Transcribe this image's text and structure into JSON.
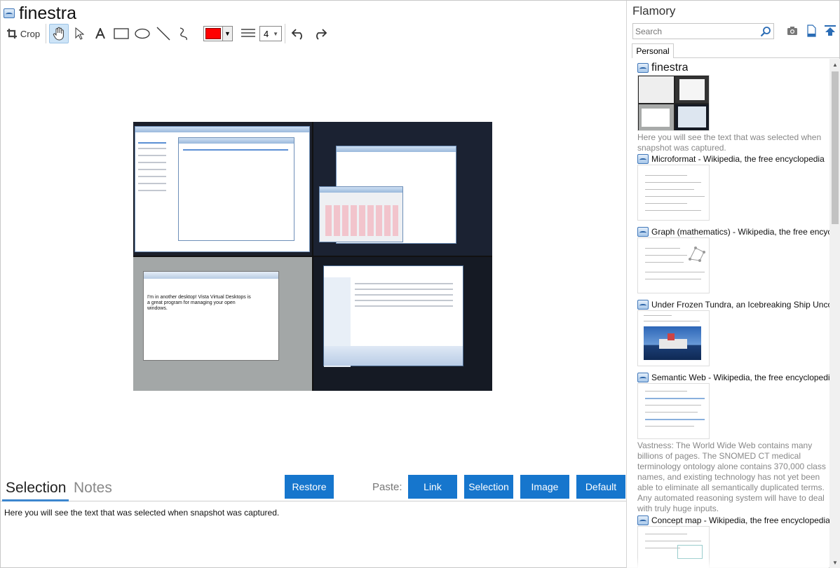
{
  "header": {
    "title": "finestra"
  },
  "toolbar": {
    "crop_label": "Crop",
    "line_width": "4",
    "accent_color": "#ff0000"
  },
  "canvas": {
    "q3_text": "I'm in another desktop! Vista Virtual Desktops is a great program for managing your open windows."
  },
  "bottom": {
    "tabs": [
      "Selection",
      "Notes"
    ],
    "restore_label": "Restore",
    "paste_label": "Paste:",
    "buttons": [
      "Link",
      "Selection",
      "Image",
      "Default"
    ],
    "selection_text": "Here you will see the text that was selected when snapshot was captured."
  },
  "sidebar": {
    "title": "Flamory",
    "search_placeholder": "Search",
    "tab": "Personal",
    "items": [
      {
        "title": "finestra",
        "desc": "Here you will see the text that was selected when snapshot was captured."
      },
      {
        "title": "Microformat - Wikipedia, the free encyclopedia"
      },
      {
        "title": "Graph (mathematics) - Wikipedia, the free encyclopedia"
      },
      {
        "title": "Under Frozen Tundra, an Icebreaking Ship Uncovers..."
      },
      {
        "title": "Semantic Web - Wikipedia, the free encyclopedia",
        "desc": "Vastness: The World Wide Web contains many billions of pages. The SNOMED CT medical terminology ontology alone contains 370,000 class names, and existing technology has not yet been able to eliminate all semantically duplicated terms. Any automated reasoning system will have to deal with truly huge inputs."
      },
      {
        "title": "Concept map - Wikipedia, the free encyclopedia"
      }
    ]
  },
  "colors": {
    "accent": "#1676cd",
    "tab_underline": "#3d87cf"
  }
}
